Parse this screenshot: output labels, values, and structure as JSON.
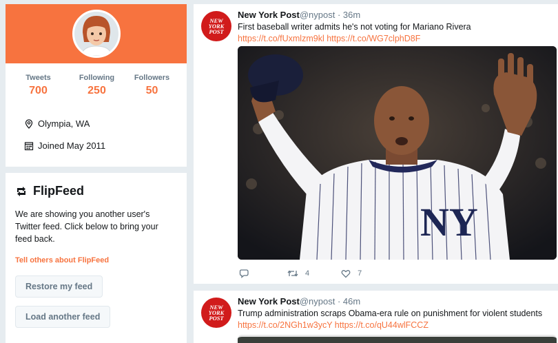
{
  "profile": {
    "stats": [
      {
        "label": "Tweets",
        "value": "700"
      },
      {
        "label": "Following",
        "value": "250"
      },
      {
        "label": "Followers",
        "value": "50"
      }
    ],
    "location": "Olympia, WA",
    "joined": "Joined May 2011"
  },
  "flipfeed": {
    "title": "FlipFeed",
    "description": "We are showing you another user's Twitter feed. Click below to bring your feed back.",
    "share_link": "Tell others about FlipFeed",
    "restore_button": "Restore my feed",
    "load_button": "Load another feed"
  },
  "tweets": [
    {
      "avatar_text": "NEW YORK POST",
      "name": "New York Post",
      "handle": "@nypost",
      "time": " · 36m",
      "text": "First baseball writer admits he's not voting for Mariano Rivera",
      "links": "https://t.co/fUxmlzm9kl https://t.co/WG7clphD8F",
      "replies": "",
      "retweets": "4",
      "likes": "7"
    },
    {
      "avatar_text": "NEW YORK POST",
      "name": "New York Post",
      "handle": "@nypost",
      "time": " · 46m",
      "text": "Trump administration scraps Obama-era rule on punishment for violent students",
      "links": "https://t.co/2NGh1w3ycY https://t.co/qU44wlFCCZ"
    }
  ],
  "colors": {
    "accent": "#f7733f",
    "background": "#e6ecf0",
    "nypost_red": "#d11b1b"
  }
}
